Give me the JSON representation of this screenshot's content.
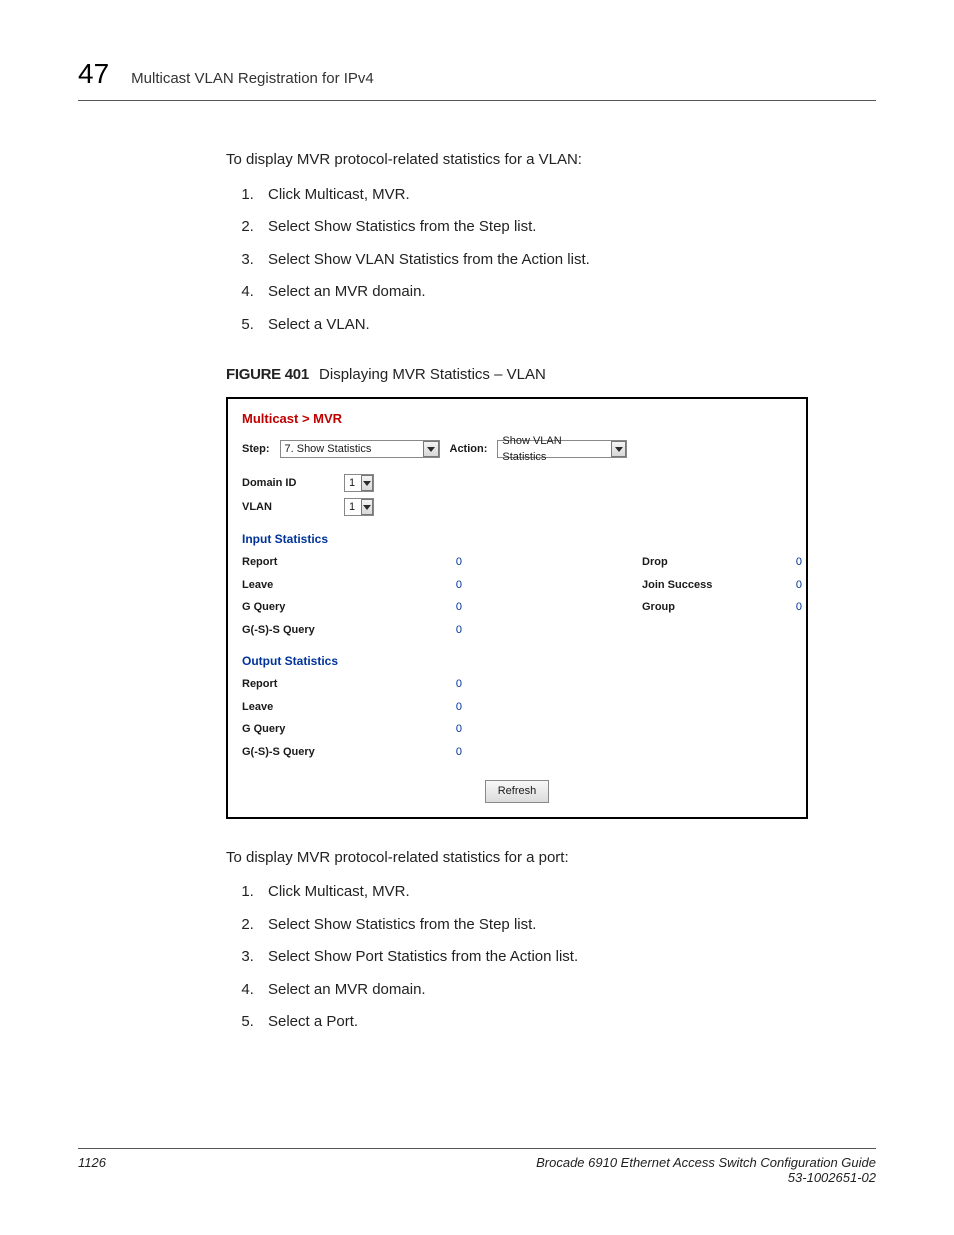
{
  "header": {
    "chapter_num": "47",
    "chapter_title": "Multicast VLAN Registration for IPv4"
  },
  "block1": {
    "intro": "To display MVR protocol-related statistics for a VLAN:",
    "steps": [
      "Click Multicast, MVR.",
      "Select Show Statistics from the Step list.",
      "Select Show VLAN Statistics from the Action list.",
      "Select an MVR domain.",
      "Select a VLAN."
    ]
  },
  "figure": {
    "label": "FIGURE 401",
    "title": "Displaying MVR Statistics – VLAN"
  },
  "screenshot": {
    "breadcrumb": "Multicast > MVR",
    "step_label": "Step:",
    "step_value": "7. Show Statistics",
    "action_label": "Action:",
    "action_value": "Show VLAN Statistics",
    "domain_label": "Domain ID",
    "domain_value": "1",
    "vlan_label": "VLAN",
    "vlan_value": "1",
    "input_heading": "Input Statistics",
    "input_rows": [
      {
        "l": "Report",
        "lv": "0",
        "r": "Drop",
        "rv": "0"
      },
      {
        "l": "Leave",
        "lv": "0",
        "r": "Join Success",
        "rv": "0"
      },
      {
        "l": "G Query",
        "lv": "0",
        "r": "Group",
        "rv": "0"
      },
      {
        "l": "G(-S)-S Query",
        "lv": "0",
        "r": "",
        "rv": ""
      }
    ],
    "output_heading": "Output Statistics",
    "output_rows": [
      {
        "l": "Report",
        "lv": "0"
      },
      {
        "l": "Leave",
        "lv": "0"
      },
      {
        "l": "G Query",
        "lv": "0"
      },
      {
        "l": "G(-S)-S Query",
        "lv": "0"
      }
    ],
    "refresh": "Refresh"
  },
  "block2": {
    "intro": "To display MVR protocol-related statistics for a port:",
    "steps": [
      "Click Multicast, MVR.",
      "Select Show Statistics from the Step list.",
      "Select Show Port Statistics from the Action list.",
      "Select an MVR domain.",
      "Select a Port."
    ]
  },
  "footer": {
    "page": "1126",
    "title": "Brocade 6910 Ethernet Access Switch Configuration Guide",
    "partnum": "53-1002651-02"
  }
}
